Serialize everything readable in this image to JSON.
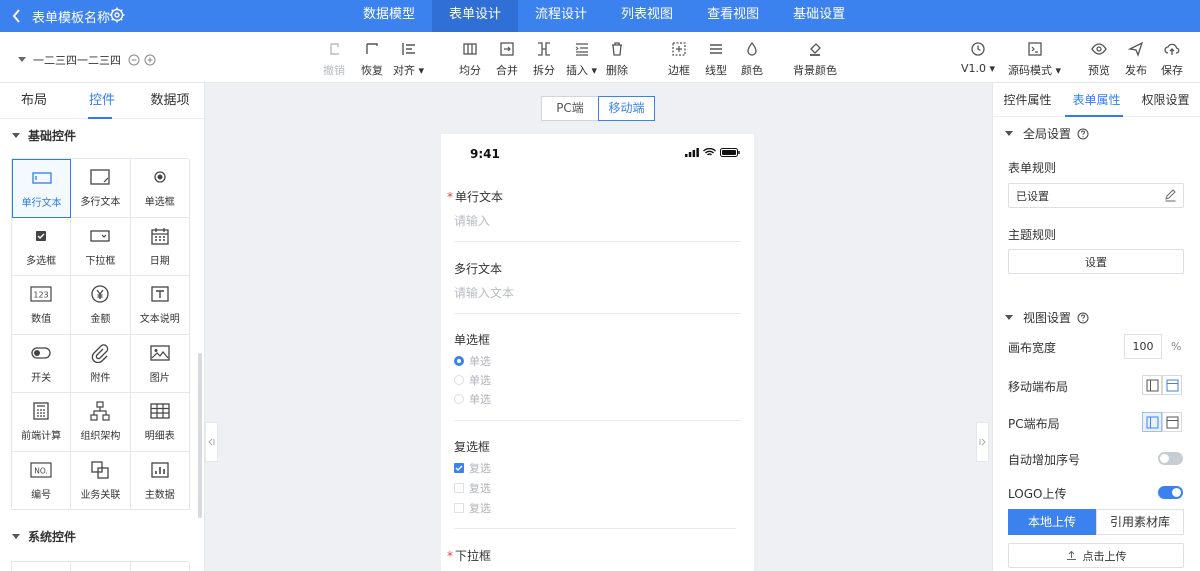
{
  "header": {
    "title": "表单模板名称",
    "tabs": [
      "数据模型",
      "表单设计",
      "流程设计",
      "列表视图",
      "查看视图",
      "基础设置"
    ],
    "active_tab": "表单设计",
    "accent_color": "#3c82ee"
  },
  "toolbar": {
    "path": "一二三四一二三四",
    "undo": "撤销",
    "redo": "恢复",
    "align": "对齐",
    "even": "均分",
    "merge": "合并",
    "split": "拆分",
    "insert": "插入",
    "delete": "删除",
    "border": "边框",
    "line": "线型",
    "color": "颜色",
    "bg_color": "背景颜色",
    "version": "V1.0",
    "source_mode": "源码模式",
    "preview": "预览",
    "publish": "发布",
    "save": "保存"
  },
  "left_panel": {
    "tabs": [
      "布局",
      "控件",
      "数据项"
    ],
    "active_tab": "控件",
    "basic_section": "基础控件",
    "controls": [
      {
        "label": "单行文本",
        "icon": "single-line-text-icon"
      },
      {
        "label": "多行文本",
        "icon": "multi-line-text-icon"
      },
      {
        "label": "单选框",
        "icon": "radio-icon"
      },
      {
        "label": "多选框",
        "icon": "checkbox-icon"
      },
      {
        "label": "下拉框",
        "icon": "dropdown-icon"
      },
      {
        "label": "日期",
        "icon": "calendar-icon"
      },
      {
        "label": "数值",
        "icon": "number-icon"
      },
      {
        "label": "金额",
        "icon": "yuan-icon"
      },
      {
        "label": "文本说明",
        "icon": "text-description-icon"
      },
      {
        "label": "开关",
        "icon": "switch-icon"
      },
      {
        "label": "附件",
        "icon": "paperclip-icon"
      },
      {
        "label": "图片",
        "icon": "image-icon"
      },
      {
        "label": "前端计算",
        "icon": "calculator-icon"
      },
      {
        "label": "组织架构",
        "icon": "org-chart-icon"
      },
      {
        "label": "明细表",
        "icon": "table-icon"
      },
      {
        "label": "编号",
        "icon": "serial-number-icon"
      },
      {
        "label": "业务关联",
        "icon": "link-copy-icon"
      },
      {
        "label": "主数据",
        "icon": "bar-chart-icon"
      }
    ],
    "system_section": "系统控件"
  },
  "canvas": {
    "mode_tabs": [
      "PC端",
      "移动端"
    ],
    "active_mode": "移动端",
    "status_time": "9:41",
    "fields": {
      "single_line": {
        "label": "单行文本",
        "placeholder": "请输入",
        "required": true
      },
      "multi_line": {
        "label": "多行文本",
        "placeholder": "请输入文本"
      },
      "radio": {
        "label": "单选框",
        "options": [
          "单选",
          "单选",
          "单选"
        ]
      },
      "checkbox": {
        "label": "复选框",
        "options": [
          "复选",
          "复选",
          "复选"
        ]
      },
      "dropdown": {
        "label": "下拉框",
        "required": true
      }
    },
    "required_mark": "*"
  },
  "right_panel": {
    "tabs": [
      "控件属性",
      "表单属性",
      "权限设置"
    ],
    "active_tab": "表单属性",
    "global_section": "全局设置",
    "form_rules_label": "表单规则",
    "form_rules_value": "已设置",
    "theme_rules_label": "主题规则",
    "theme_rules_button": "设置",
    "view_section": "视图设置",
    "canvas_width_label": "画布宽度",
    "canvas_width_value": "100",
    "canvas_width_unit": "%",
    "mobile_layout_label": "移动端布局",
    "pc_layout_label": "PC端布局",
    "auto_serial_label": "自动增加序号",
    "auto_serial_on": false,
    "logo_label": "LOGO上传",
    "logo_on": true,
    "upload_tabs": [
      "本地上传",
      "引用素材库"
    ],
    "upload_button": "点击上传"
  }
}
